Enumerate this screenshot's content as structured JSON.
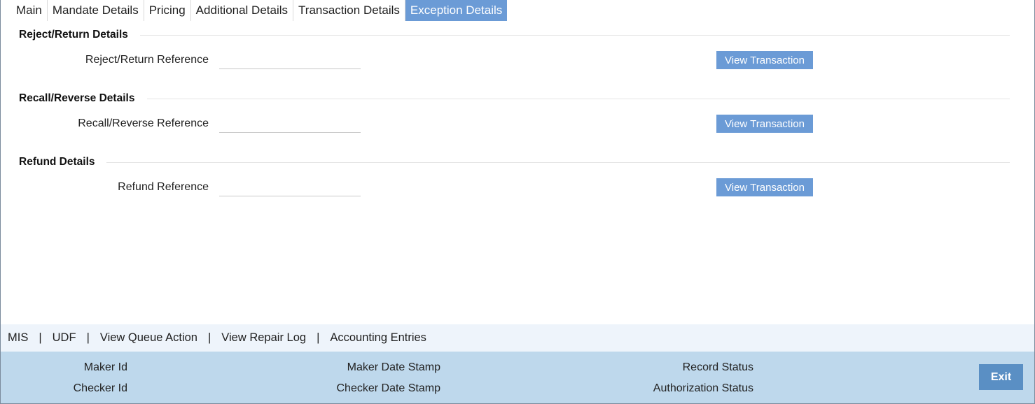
{
  "tabs": [
    {
      "label": "Main"
    },
    {
      "label": "Mandate Details"
    },
    {
      "label": "Pricing"
    },
    {
      "label": "Additional Details"
    },
    {
      "label": "Transaction Details"
    },
    {
      "label": "Exception Details",
      "active": true
    }
  ],
  "sections": {
    "reject_return": {
      "title": "Reject/Return Details",
      "field_label": "Reject/Return Reference",
      "field_value": "",
      "button_label": "View Transaction"
    },
    "recall_reverse": {
      "title": "Recall/Reverse Details",
      "field_label": "Recall/Reverse Reference",
      "field_value": "",
      "button_label": "View Transaction"
    },
    "refund": {
      "title": "Refund Details",
      "field_label": "Refund Reference",
      "field_value": "",
      "button_label": "View Transaction"
    }
  },
  "links": {
    "mis": "MIS",
    "udf": "UDF",
    "view_queue_action": "View Queue Action",
    "view_repair_log": "View Repair Log",
    "accounting_entries": "Accounting Entries",
    "separator": "|"
  },
  "footer": {
    "maker_id": "Maker Id",
    "checker_id": "Checker Id",
    "maker_date_stamp": "Maker Date Stamp",
    "checker_date_stamp": "Checker Date Stamp",
    "record_status": "Record Status",
    "authorization_status": "Authorization Status",
    "exit_label": "Exit"
  },
  "colors": {
    "accent": "#6b9bd6",
    "footer_bg": "#bed8ec",
    "linkbar_bg": "#eef4fb",
    "exit_bg": "#5a8fc4"
  }
}
